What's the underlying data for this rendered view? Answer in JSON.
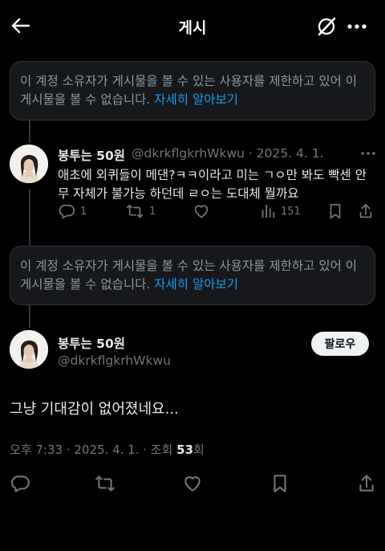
{
  "header": {
    "title": "게시"
  },
  "notice": {
    "text": "이 계정 소유자가 게시물을 볼 수 있는 사용자를 제한하고 있어 이 게시물을 볼 수 없습니다.",
    "link": "자세히 알아보기"
  },
  "reply_tweet": {
    "name": "봉투는 50원",
    "handle_date": "@dkrkflgkrhWkwu · 2025. 4. 1.",
    "text": "애초에 외퀴들이 메댄?ㅋㅋ이라고 미는 ㄱㅇ만 봐도 빡센 안무 자체가 불가능 하던데 ㄹㅇ는 도대체 뭘까요",
    "replies": "1",
    "retweets": "1",
    "views": "151"
  },
  "main_tweet": {
    "name": "봉투는 50원",
    "handle": "@dkrkflgkrhWkwu",
    "follow_label": "팔로우",
    "text": "그냥 기대감이 없어졌네요...",
    "meta_prefix": "오후 7:33 · 2025. 4. 1. · 조회 ",
    "views": "53",
    "views_suffix": "회"
  },
  "colors": {
    "background": "#000000",
    "accent": "#1d9bf0",
    "muted": "#71767b",
    "text": "#e7e9ea"
  },
  "icons": [
    "back-arrow-icon",
    "grok-icon",
    "more-icon",
    "reply-icon",
    "retweet-icon",
    "like-icon",
    "views-icon",
    "bookmark-icon",
    "share-icon"
  ]
}
